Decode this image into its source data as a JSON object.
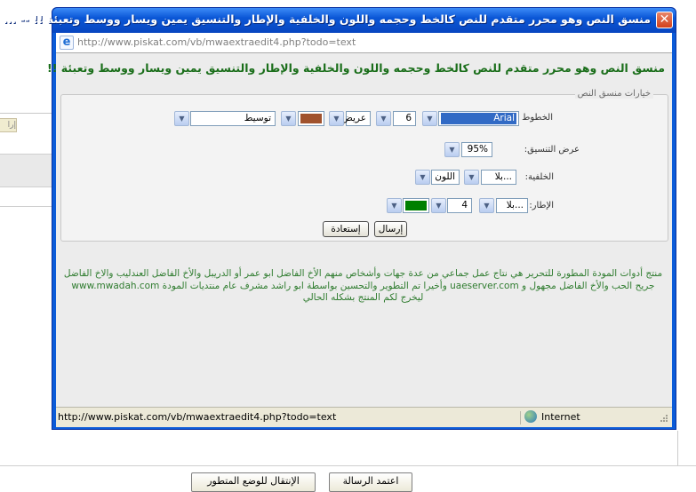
{
  "window": {
    "title": "منسق النص وهو محرر متقدم للنص كالخط وحجمه واللون والخلفية والإطار والتنسيق يمين ويسار ووسط وتعبئة !! -- ...",
    "address": "http://www.piskat.com/vb/mwaextraedit4.php?todo=text",
    "close_icon": "close-icon"
  },
  "content": {
    "heading": "منسق النص وهو محرر متقدم للنص كالخط وحجمه واللون والخلفية والإطار والتنسيق يمين ويسار ووسط وتعبئة !!",
    "legend": "خيارات منسق النص",
    "fields": {
      "font_label": "الخطوط",
      "font_value": "Arial",
      "size_value": "6",
      "weight_value": "عريض",
      "text_color": "#a0522d",
      "align_value": "توسيط",
      "width_label": "عرض التنسيق:",
      "width_value": "95%",
      "bg_label": "الخلفية:",
      "bg_value": "بلا...",
      "bg_color_value": "اللون",
      "border_label": "الإطار:",
      "border_style_value": "بلا...",
      "border_width_value": "4",
      "border_color": "#008000"
    },
    "buttons": {
      "send": "إرسال",
      "restore": "إستعادة"
    },
    "credits": "منتج أدوات المودة المطورة للتحرير هي نتاج عمل جماعي من عدة جهات وأشخاص منهم الأخ الفاضل ابو عمر أو الدريبل والأخ الفاضل العندليب والاخ الفاضل جريح الحب والأخ الفاضل مجهول و uaeserver.com وأخيرا تم التطوير والتحسين بواسطة ابو راشد مشرف عام منتديات المودة www.mwadah.com ليخرج لكم المنتج بشكله الحالي"
  },
  "status": {
    "url": "http://www.piskat.com/vb/mwaextraedit4.php?todo=text",
    "zone": "Internet"
  },
  "page": {
    "chip_text": "إرا",
    "btn_approve": "اعتمد الرسالة",
    "btn_advanced": "الإنتقال للوضع المتطور"
  }
}
